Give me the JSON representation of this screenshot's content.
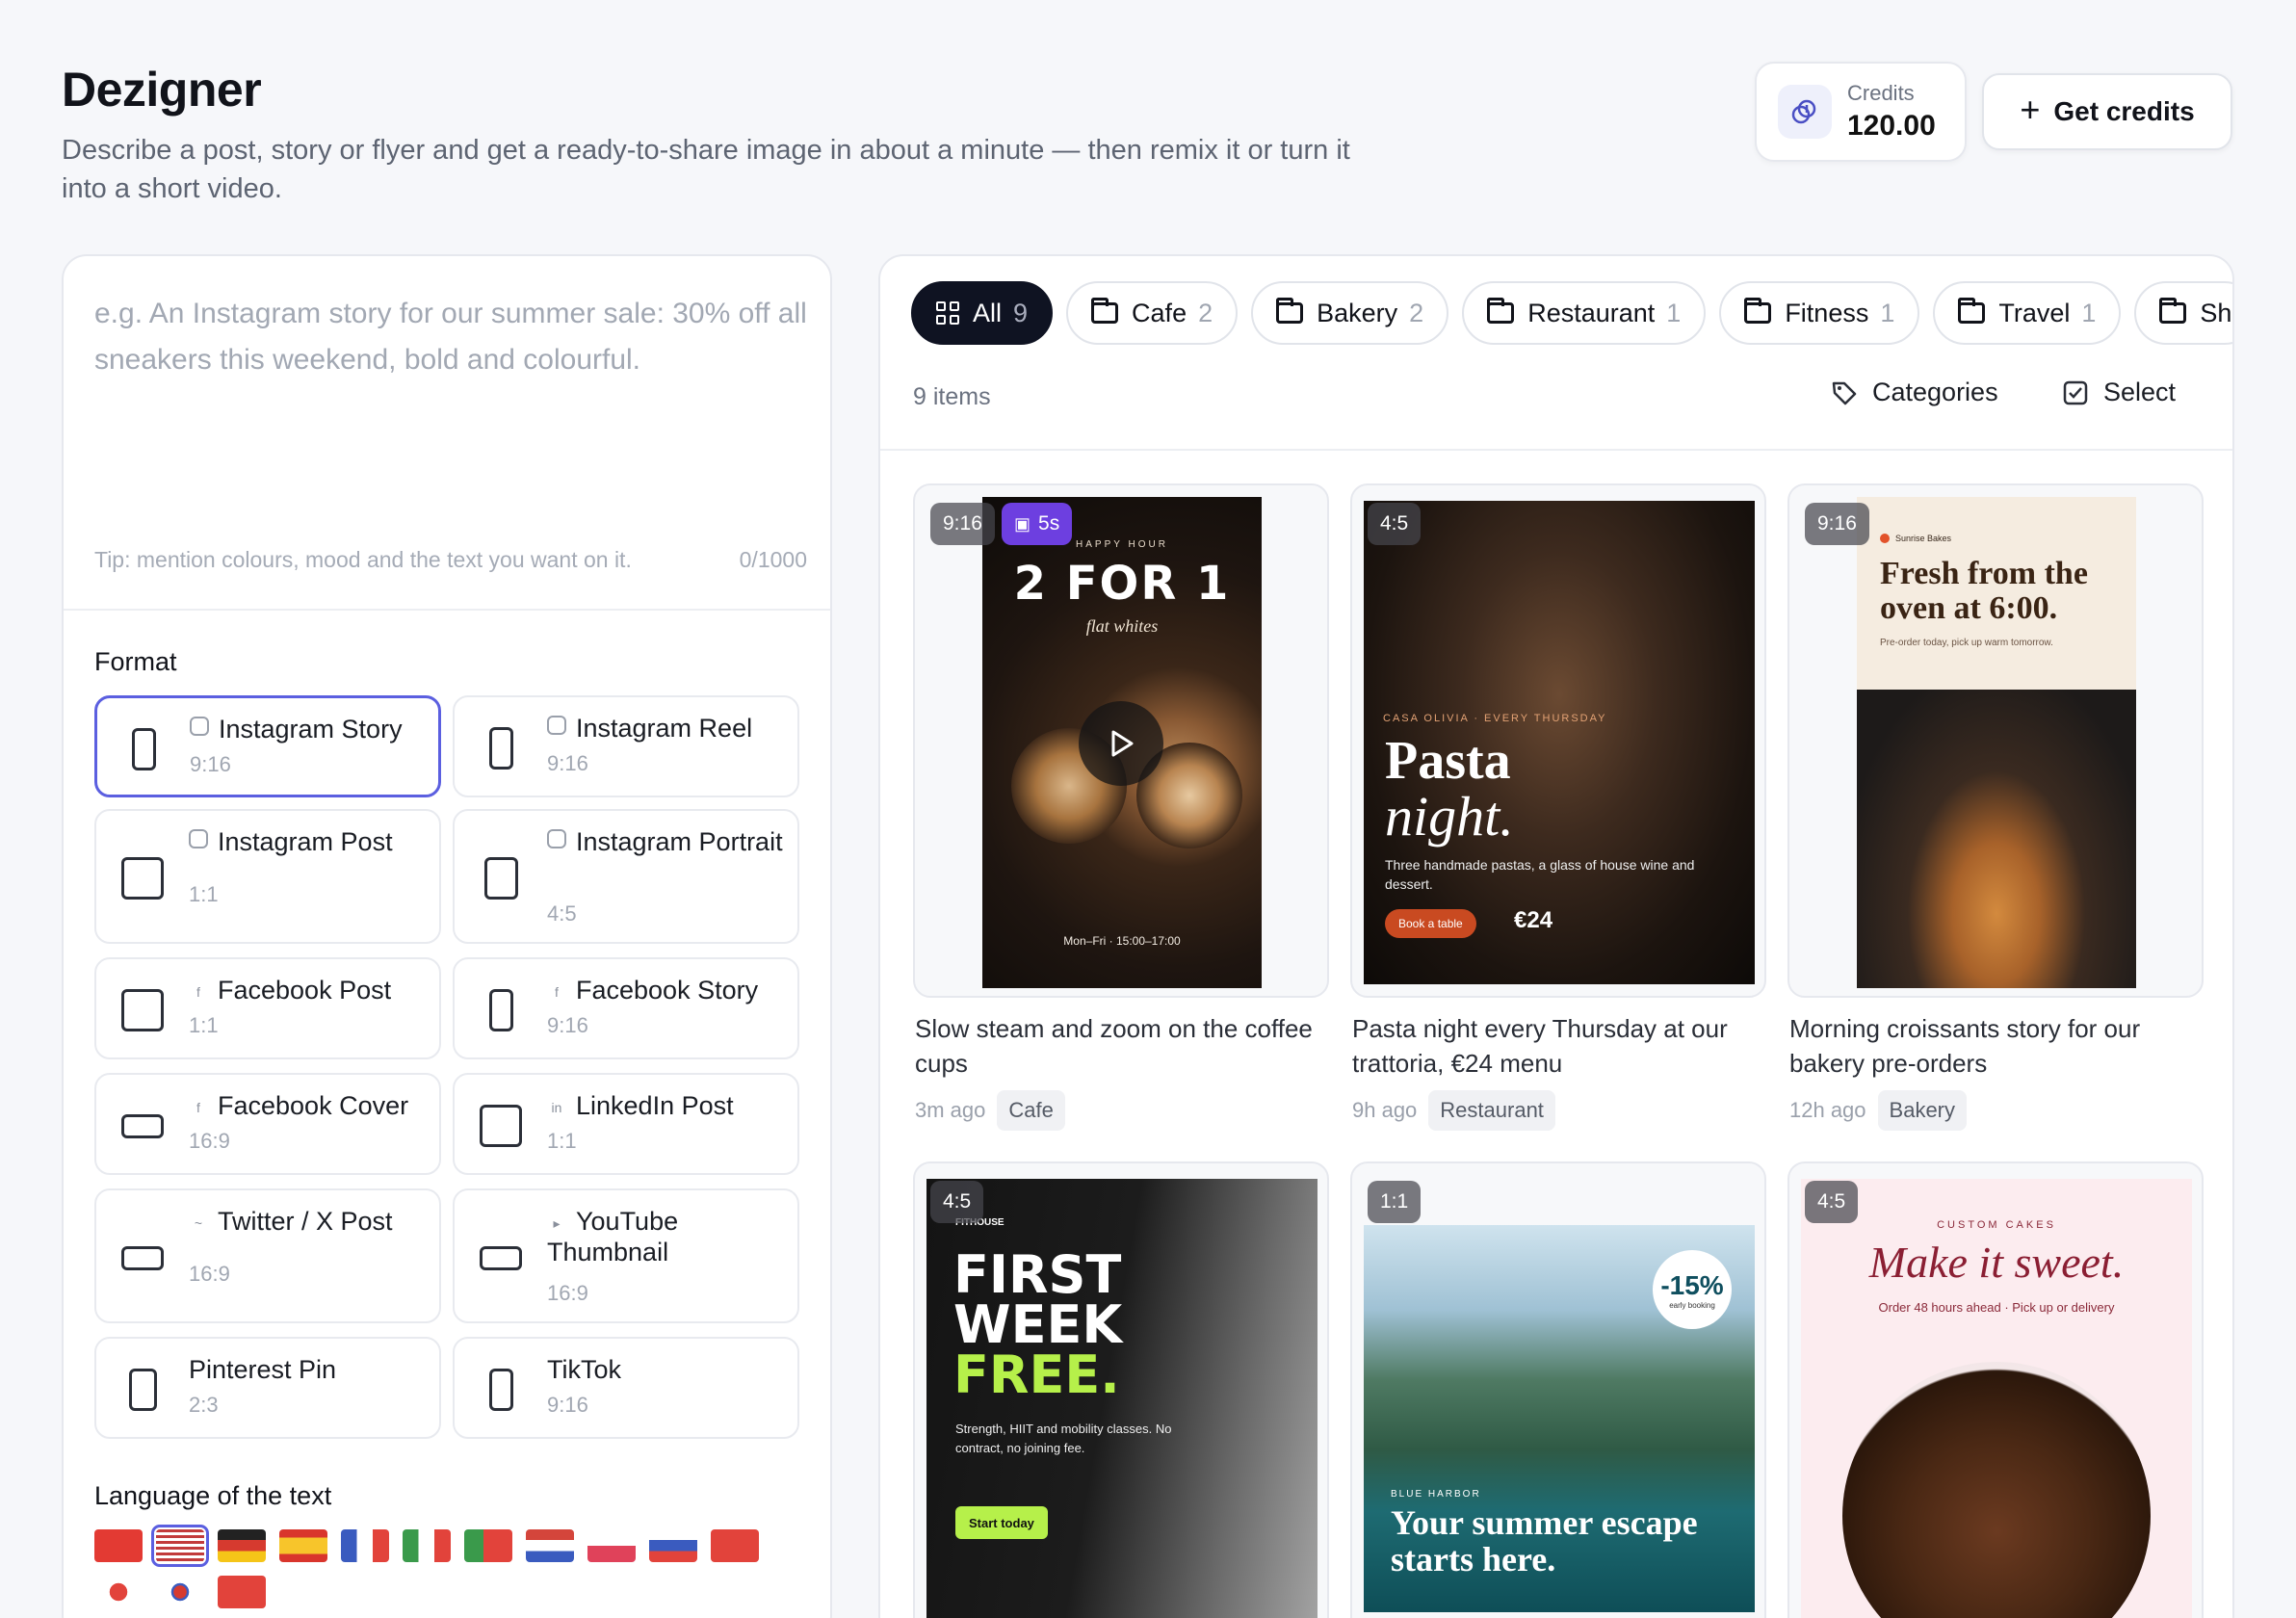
{
  "header": {
    "title": "Dezigner",
    "description": "Describe a post, story or flyer and get a ready-to-share image in about a minute — then remix it or turn it into a short video.",
    "credits_label": "Credits",
    "credits_value": "120.00",
    "get_credits_label": "Get credits"
  },
  "composer": {
    "placeholder": "e.g. An Instagram story for our summer sale: 30% off all sneakers this weekend, bold and colourful.",
    "tip": "Tip: mention colours, mood and the text you want on it.",
    "char_count": "0/1000",
    "format_label": "Format",
    "formats": [
      {
        "name": "Instagram Story",
        "ratio": "9:16",
        "icon": "instagram-icon",
        "selected": true
      },
      {
        "name": "Instagram Reel",
        "ratio": "9:16",
        "icon": "instagram-icon"
      },
      {
        "name": "Instagram Post",
        "ratio": "1:1",
        "icon": "instagram-icon"
      },
      {
        "name": "Instagram Portrait",
        "ratio": "4:5",
        "icon": "instagram-icon"
      },
      {
        "name": "Facebook Post",
        "ratio": "1:1",
        "icon": "facebook-icon"
      },
      {
        "name": "Facebook Story",
        "ratio": "9:16",
        "icon": "facebook-icon"
      },
      {
        "name": "Facebook Cover",
        "ratio": "16:9",
        "icon": "facebook-icon"
      },
      {
        "name": "LinkedIn Post",
        "ratio": "1:1",
        "icon": "linkedin-icon"
      },
      {
        "name": "Twitter / X Post",
        "ratio": "16:9",
        "icon": "twitter-icon"
      },
      {
        "name": "YouTube Thumbnail",
        "ratio": "16:9",
        "icon": "youtube-icon"
      },
      {
        "name": "Pinterest Pin",
        "ratio": "2:3",
        "icon": ""
      },
      {
        "name": "TikTok",
        "ratio": "9:16",
        "icon": ""
      }
    ],
    "language_label": "Language of the text",
    "languages": [
      "Albanian",
      "English (US)",
      "German",
      "Spanish",
      "French",
      "Italian",
      "Portuguese",
      "Dutch",
      "Polish",
      "Russian",
      "Chinese",
      "Japanese",
      "Korean",
      "Turkish"
    ],
    "selected_language": "English (US)"
  },
  "gallery": {
    "chips": [
      {
        "label": "All",
        "count": "9",
        "active": true
      },
      {
        "label": "Cafe",
        "count": "2"
      },
      {
        "label": "Bakery",
        "count": "2"
      },
      {
        "label": "Restaurant",
        "count": "1"
      },
      {
        "label": "Fitness",
        "count": "1"
      },
      {
        "label": "Travel",
        "count": "1"
      },
      {
        "label": "Sh",
        "count": ""
      }
    ],
    "items_count": "9 items",
    "categories_label": "Categories",
    "select_label": "Select",
    "cards": [
      {
        "ratio": "9:16",
        "duration": "5s",
        "caption": "Slow steam and zoom on the coffee cups",
        "time": "3m ago",
        "category": "Cafe",
        "art": {
          "kicker": "HAPPY HOUR",
          "headline": "2 FOR 1",
          "sub": "flat whites",
          "footer": "Mon–Fri · 15:00–17:00"
        }
      },
      {
        "ratio": "4:5",
        "caption": "Pasta night every Thursday at our trattoria, €24 menu",
        "time": "9h ago",
        "category": "Restaurant",
        "art": {
          "kicker": "CASA OLIVIA · EVERY THURSDAY",
          "headline": "Pasta",
          "headline2": "night.",
          "sub": "Three handmade pastas, a glass of house wine and dessert.",
          "cta": "Book a table",
          "price": "€24"
        }
      },
      {
        "ratio": "9:16",
        "caption": "Morning croissants story for our bakery pre-orders",
        "time": "12h ago",
        "category": "Bakery",
        "art": {
          "brand": "Sunrise Bakes",
          "headline": "Fresh from the oven at 6:00.",
          "sub": "Pre-order today, pick up warm tomorrow."
        }
      },
      {
        "ratio": "4:5",
        "art": {
          "brand": "FITHOUSE",
          "line1": "FIRST",
          "line2": "WEEK",
          "line3": "FREE.",
          "sub": "Strength, HIIT and mobility classes. No contract, no joining fee.",
          "cta": "Start today"
        }
      },
      {
        "ratio": "1:1",
        "art": {
          "discount": "-15%",
          "discount_sub": "early booking",
          "brand": "BLUE HARBOR",
          "headline": "Your summer escape starts here."
        }
      },
      {
        "ratio": "4:5",
        "art": {
          "kicker": "CUSTOM CAKES",
          "headline": "Make it sweet.",
          "sub": "Order 48 hours ahead · Pick up or delivery"
        }
      }
    ]
  }
}
